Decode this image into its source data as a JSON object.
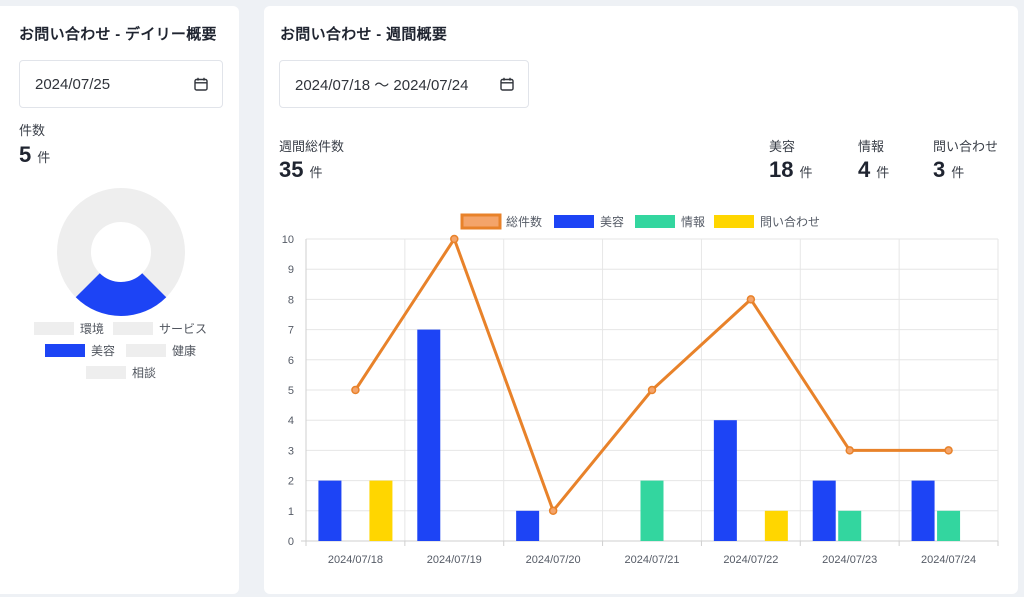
{
  "daily": {
    "title": "お問い合わせ - デイリー概要",
    "date": "2024/07/25",
    "count_label": "件数",
    "count_value": "5",
    "count_unit": "件",
    "donut": {
      "legend": [
        {
          "label": "環境",
          "color": "#eeeeee"
        },
        {
          "label": "サービス",
          "color": "#eeeeee"
        },
        {
          "label": "美容",
          "color": "#1d44f5"
        },
        {
          "label": "健康",
          "color": "#eeeeee"
        },
        {
          "label": "相談",
          "color": "#eeeeee"
        }
      ],
      "highlight_fraction": 0.25,
      "highlight_color": "#1d44f5",
      "base_color": "#eeeeee"
    }
  },
  "weekly": {
    "title": "お問い合わせ - 週間概要",
    "date_range": "2024/07/18 〜 2024/07/24",
    "total_label": "週間総件数",
    "total_value": "35",
    "unit": "件",
    "breakdown": [
      {
        "label": "美容",
        "value": "18"
      },
      {
        "label": "情報",
        "value": "4"
      },
      {
        "label": "問い合わせ",
        "value": "3"
      }
    ]
  },
  "chart_data": {
    "type": "bar",
    "categories": [
      "2024/07/18",
      "2024/07/19",
      "2024/07/20",
      "2024/07/21",
      "2024/07/22",
      "2024/07/23",
      "2024/07/24"
    ],
    "ylim": [
      0,
      10
    ],
    "yticks": [
      0,
      1,
      2,
      3,
      4,
      5,
      6,
      7,
      8,
      9,
      10
    ],
    "grid": true,
    "legend_position": "top",
    "line_series": {
      "name": "総件数",
      "values": [
        5,
        10,
        1,
        5,
        8,
        3,
        3
      ],
      "color": "#e8822a",
      "fill": "#f4a46a"
    },
    "series": [
      {
        "name": "美容",
        "values": [
          2,
          7,
          1,
          0,
          4,
          2,
          2
        ],
        "color": "#1d44f5"
      },
      {
        "name": "情報",
        "values": [
          0,
          0,
          0,
          2,
          0,
          1,
          1
        ],
        "color": "#33d69f"
      },
      {
        "name": "問い合わせ",
        "values": [
          2,
          0,
          0,
          0,
          1,
          0,
          0
        ],
        "color": "#ffd600"
      }
    ]
  }
}
